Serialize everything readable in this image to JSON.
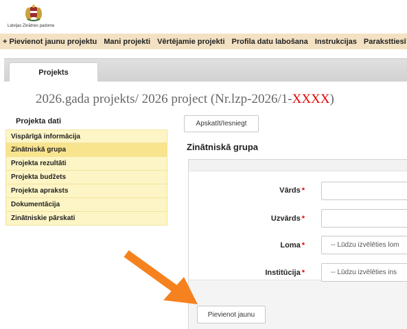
{
  "header": {
    "org_name": "Latvijas Zinātnes padome"
  },
  "topnav": {
    "items": [
      "+ Pievienot jaunu projektu",
      "Mani projekti",
      "Vērtējamie projekti",
      "Profila datu labošana",
      "Instrukcijas",
      "Paraksttiesī"
    ]
  },
  "tabs": {
    "active": "Projekts"
  },
  "title": {
    "prefix": "2026.gada projekts/ 2026 project (Nr.lzp-2026/1-",
    "code": "XXXX",
    "suffix": ")",
    "code_color": "#e40000"
  },
  "sidebar": {
    "heading": "Projekta dati",
    "items": [
      "Vispārīgā informācija",
      "Zinātniskā grupa",
      "Projekta rezultāti",
      "Projekta budžets",
      "Projekta apraksts",
      "Dokumentācija",
      "Zinātniskie pārskati"
    ],
    "active_index": 1
  },
  "main": {
    "view_submit_label": "Apskatīt/Iesniegt",
    "section_heading": "Zinātniskā grupa",
    "required_marker": "*",
    "form": {
      "name_label": "Vārds",
      "surname_label": "Uzvārds",
      "role_label": "Loma",
      "role_value": "-- Lūdzu izvēlēties lom",
      "institution_label": "Institūcija",
      "institution_value": "-- Lūdzu izvēlēties ins"
    },
    "add_new_label": "Pievienot jaunu"
  },
  "colors": {
    "nav_bg": "#f3e1c3",
    "sidebar_bg": "#fdf5c5",
    "sidebar_active_bg": "#f9e48e",
    "required": "#e40000",
    "arrow": "#f5821f"
  },
  "icons": {
    "logo": "coat-of-arms-icon",
    "pointer": "orange-arrow-icon"
  }
}
